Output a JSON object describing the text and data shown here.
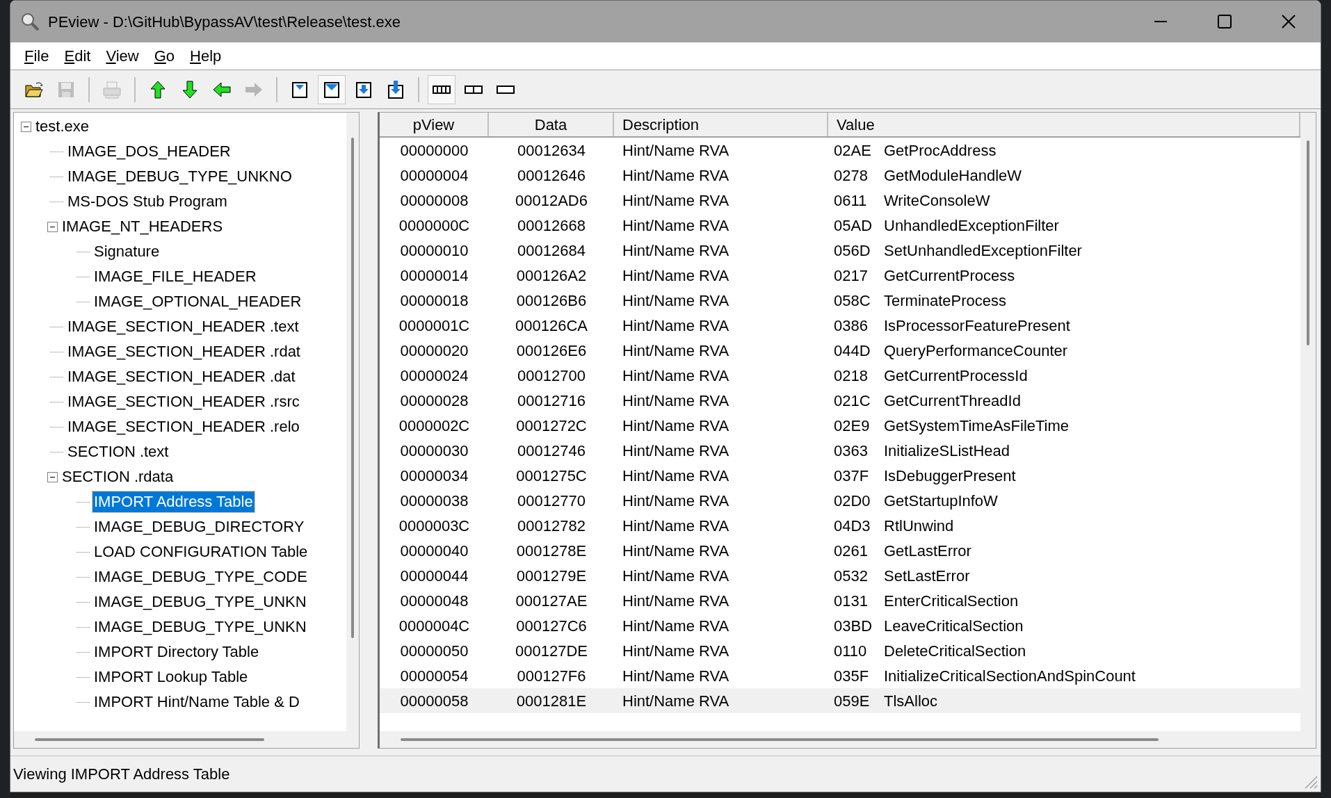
{
  "window": {
    "title": "PEview - D:\\GitHub\\BypassAV\\test\\Release\\test.exe"
  },
  "menu": [
    {
      "label": "File"
    },
    {
      "label": "Edit"
    },
    {
      "label": "View"
    },
    {
      "label": "Go"
    },
    {
      "label": "Help"
    }
  ],
  "toolbar": [
    {
      "kind": "open",
      "disabled": false,
      "pressed": false
    },
    {
      "kind": "save",
      "disabled": true,
      "pressed": false
    },
    {
      "kind": "separator"
    },
    {
      "kind": "print",
      "disabled": true,
      "pressed": false
    },
    {
      "kind": "separator"
    },
    {
      "kind": "up",
      "disabled": false,
      "pressed": false
    },
    {
      "kind": "down",
      "disabled": false,
      "pressed": false
    },
    {
      "kind": "back",
      "disabled": false,
      "pressed": false
    },
    {
      "kind": "forward",
      "disabled": true,
      "pressed": false
    },
    {
      "kind": "separator"
    },
    {
      "kind": "doc-top",
      "disabled": false,
      "pressed": false
    },
    {
      "kind": "doc-frame",
      "disabled": false,
      "pressed": true
    },
    {
      "kind": "doc-down",
      "disabled": false,
      "pressed": false
    },
    {
      "kind": "doc-end",
      "disabled": false,
      "pressed": false
    },
    {
      "kind": "separator"
    },
    {
      "kind": "view-cells",
      "disabled": false,
      "pressed": true
    },
    {
      "kind": "view-split",
      "disabled": false,
      "pressed": false
    },
    {
      "kind": "view-single",
      "disabled": false,
      "pressed": false
    }
  ],
  "tree": {
    "label": "test.exe",
    "expanded": true,
    "selected": false,
    "children": [
      {
        "label": "IMAGE_DOS_HEADER",
        "selected": false
      },
      {
        "label": "IMAGE_DEBUG_TYPE_UNKNO",
        "selected": false
      },
      {
        "label": "MS-DOS Stub Program",
        "selected": false
      },
      {
        "label": "IMAGE_NT_HEADERS",
        "expanded": true,
        "selected": false,
        "children": [
          {
            "label": "Signature",
            "selected": false
          },
          {
            "label": "IMAGE_FILE_HEADER",
            "selected": false
          },
          {
            "label": "IMAGE_OPTIONAL_HEADER",
            "selected": false
          }
        ]
      },
      {
        "label": "IMAGE_SECTION_HEADER .text",
        "selected": false
      },
      {
        "label": "IMAGE_SECTION_HEADER .rdat",
        "selected": false
      },
      {
        "label": "IMAGE_SECTION_HEADER .dat",
        "selected": false
      },
      {
        "label": "IMAGE_SECTION_HEADER .rsrc",
        "selected": false
      },
      {
        "label": "IMAGE_SECTION_HEADER .relo",
        "selected": false
      },
      {
        "label": "SECTION .text",
        "selected": false
      },
      {
        "label": "SECTION .rdata",
        "expanded": true,
        "selected": false,
        "children": [
          {
            "label": "IMPORT Address Table",
            "selected": true
          },
          {
            "label": "IMAGE_DEBUG_DIRECTORY",
            "selected": false
          },
          {
            "label": "LOAD CONFIGURATION Table",
            "selected": false
          },
          {
            "label": "IMAGE_DEBUG_TYPE_CODE",
            "selected": false
          },
          {
            "label": "IMAGE_DEBUG_TYPE_UNKN",
            "selected": false
          },
          {
            "label": "IMAGE_DEBUG_TYPE_UNKN",
            "selected": false
          },
          {
            "label": "IMPORT Directory Table",
            "selected": false
          },
          {
            "label": "IMPORT Lookup Table",
            "selected": false
          },
          {
            "label": "IMPORT Hint/Name Table & D",
            "selected": false
          }
        ]
      }
    ]
  },
  "table": {
    "columns": [
      "pView",
      "Data",
      "Description",
      "Value"
    ],
    "rows": [
      {
        "pview": "00000000",
        "data": "00012634",
        "description": "Hint/Name RVA",
        "hint": "02AE",
        "name": "GetProcAddress",
        "selected": false
      },
      {
        "pview": "00000004",
        "data": "00012646",
        "description": "Hint/Name RVA",
        "hint": "0278",
        "name": "GetModuleHandleW",
        "selected": false
      },
      {
        "pview": "00000008",
        "data": "00012AD6",
        "description": "Hint/Name RVA",
        "hint": "0611",
        "name": "WriteConsoleW",
        "selected": false
      },
      {
        "pview": "0000000C",
        "data": "00012668",
        "description": "Hint/Name RVA",
        "hint": "05AD",
        "name": "UnhandledExceptionFilter",
        "selected": false
      },
      {
        "pview": "00000010",
        "data": "00012684",
        "description": "Hint/Name RVA",
        "hint": "056D",
        "name": "SetUnhandledExceptionFilter",
        "selected": false
      },
      {
        "pview": "00000014",
        "data": "000126A2",
        "description": "Hint/Name RVA",
        "hint": "0217",
        "name": "GetCurrentProcess",
        "selected": false
      },
      {
        "pview": "00000018",
        "data": "000126B6",
        "description": "Hint/Name RVA",
        "hint": "058C",
        "name": "TerminateProcess",
        "selected": false
      },
      {
        "pview": "0000001C",
        "data": "000126CA",
        "description": "Hint/Name RVA",
        "hint": "0386",
        "name": "IsProcessorFeaturePresent",
        "selected": false
      },
      {
        "pview": "00000020",
        "data": "000126E6",
        "description": "Hint/Name RVA",
        "hint": "044D",
        "name": "QueryPerformanceCounter",
        "selected": false
      },
      {
        "pview": "00000024",
        "data": "00012700",
        "description": "Hint/Name RVA",
        "hint": "0218",
        "name": "GetCurrentProcessId",
        "selected": false
      },
      {
        "pview": "00000028",
        "data": "00012716",
        "description": "Hint/Name RVA",
        "hint": "021C",
        "name": "GetCurrentThreadId",
        "selected": false
      },
      {
        "pview": "0000002C",
        "data": "0001272C",
        "description": "Hint/Name RVA",
        "hint": "02E9",
        "name": "GetSystemTimeAsFileTime",
        "selected": false
      },
      {
        "pview": "00000030",
        "data": "00012746",
        "description": "Hint/Name RVA",
        "hint": "0363",
        "name": "InitializeSListHead",
        "selected": false
      },
      {
        "pview": "00000034",
        "data": "0001275C",
        "description": "Hint/Name RVA",
        "hint": "037F",
        "name": "IsDebuggerPresent",
        "selected": false
      },
      {
        "pview": "00000038",
        "data": "00012770",
        "description": "Hint/Name RVA",
        "hint": "02D0",
        "name": "GetStartupInfoW",
        "selected": false
      },
      {
        "pview": "0000003C",
        "data": "00012782",
        "description": "Hint/Name RVA",
        "hint": "04D3",
        "name": "RtlUnwind",
        "selected": false
      },
      {
        "pview": "00000040",
        "data": "0001278E",
        "description": "Hint/Name RVA",
        "hint": "0261",
        "name": "GetLastError",
        "selected": false
      },
      {
        "pview": "00000044",
        "data": "0001279E",
        "description": "Hint/Name RVA",
        "hint": "0532",
        "name": "SetLastError",
        "selected": false
      },
      {
        "pview": "00000048",
        "data": "000127AE",
        "description": "Hint/Name RVA",
        "hint": "0131",
        "name": "EnterCriticalSection",
        "selected": false
      },
      {
        "pview": "0000004C",
        "data": "000127C6",
        "description": "Hint/Name RVA",
        "hint": "03BD",
        "name": "LeaveCriticalSection",
        "selected": false
      },
      {
        "pview": "00000050",
        "data": "000127DE",
        "description": "Hint/Name RVA",
        "hint": "0110",
        "name": "DeleteCriticalSection",
        "selected": false
      },
      {
        "pview": "00000054",
        "data": "000127F6",
        "description": "Hint/Name RVA",
        "hint": "035F",
        "name": "InitializeCriticalSectionAndSpinCount",
        "selected": false
      },
      {
        "pview": "00000058",
        "data": "0001281E",
        "description": "Hint/Name RVA",
        "hint": "059E",
        "name": "TlsAlloc",
        "selected": true
      }
    ]
  },
  "status_bar": {
    "text": "Viewing IMPORT Address Table"
  }
}
